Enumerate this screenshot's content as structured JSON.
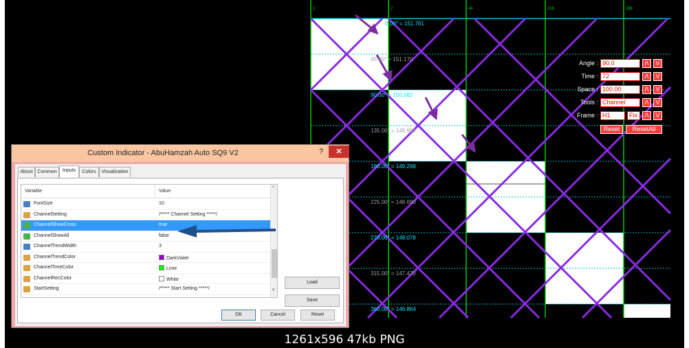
{
  "caption": "1261x596 47kb PNG",
  "chart": {
    "price_labels": [
      "0.00° = 151.761",
      "45.00° = 151.170",
      "90.00° = 150.582",
      "135.00° = 149.995",
      "180.00° = 149.298",
      "225.00° = 148.690",
      "270.00° = 148.078",
      "315.00° = 147.470",
      "360.00° = 146.864"
    ],
    "top_tick_labels": [
      "1",
      "2",
      "44",
      "216",
      "288"
    ],
    "colors": {
      "background": "#000000",
      "trend_lines": "#8a2be2",
      "time_lines": "#00cc00",
      "level_dotted": "#00bcd4",
      "label_cyan": "#00e5ff",
      "label_gray": "#9aa0a6",
      "box_fill": "#ffffff",
      "arrows": "#7b2ca0"
    }
  },
  "control_panel": {
    "rows": [
      {
        "label": "Angle :",
        "value": "90.0",
        "btn1": "Λ",
        "btn2": "V"
      },
      {
        "label": "Time :",
        "value": "72",
        "btn1": "Λ",
        "btn2": "V"
      },
      {
        "label": "Space :",
        "value": "100.00",
        "btn1": "Λ",
        "btn2": "V"
      },
      {
        "label": "Tools :",
        "value": "Channel",
        "btn1": "Λ",
        "btn2": "V"
      },
      {
        "label": "Frame :",
        "value": "H1",
        "value2": "Fix",
        "btn1": "Λ",
        "btn2": "V"
      }
    ],
    "reset_label": "Reset",
    "reset_all_label": "ResetAll"
  },
  "dialog": {
    "title": "Custom Indicator - AbuHamzah Auto SQ9 V2",
    "help_label": "?",
    "close_label": "✕",
    "tabs": [
      "About",
      "Common",
      "Inputs",
      "Colors",
      "Visualization"
    ],
    "active_tab": "Inputs",
    "columns": [
      "Variable",
      "Value"
    ],
    "rows": [
      {
        "variable": "FontSize",
        "value": "10",
        "icon": "numeric",
        "icon_color": "#4a7fc1"
      },
      {
        "variable": "ChannelSetting",
        "value": "/***** Channel Setting *****/",
        "icon": "string",
        "icon_color": "#d9a441"
      },
      {
        "variable": "ChannelShowCross",
        "value": "true",
        "icon": "bool",
        "icon_color": "#4caf50",
        "selected": true
      },
      {
        "variable": "ChannelShowAll",
        "value": "false",
        "icon": "bool",
        "icon_color": "#4caf50"
      },
      {
        "variable": "ChannelTrendWidth",
        "value": "3",
        "icon": "numeric",
        "icon_color": "#4a7fc1"
      },
      {
        "variable": "ChannelTrendColor",
        "value": "DarkViolet",
        "icon": "color",
        "icon_color": "#d9a441",
        "swatch": "#9400d3"
      },
      {
        "variable": "ChannelTimeColor",
        "value": "Lime",
        "icon": "color",
        "icon_color": "#d9a441",
        "swatch": "#00ff00"
      },
      {
        "variable": "ChannelRecColor",
        "value": "White",
        "icon": "color",
        "icon_color": "#d9a441",
        "swatch": "#ffffff"
      },
      {
        "variable": "StartSetting",
        "value": "/***** Start Setting *****/",
        "icon": "string",
        "icon_color": "#d9a441"
      }
    ],
    "load_label": "Load",
    "save_label": "Save",
    "ok_label": "OK",
    "cancel_label": "Cancel",
    "reset_label": "Reset"
  }
}
